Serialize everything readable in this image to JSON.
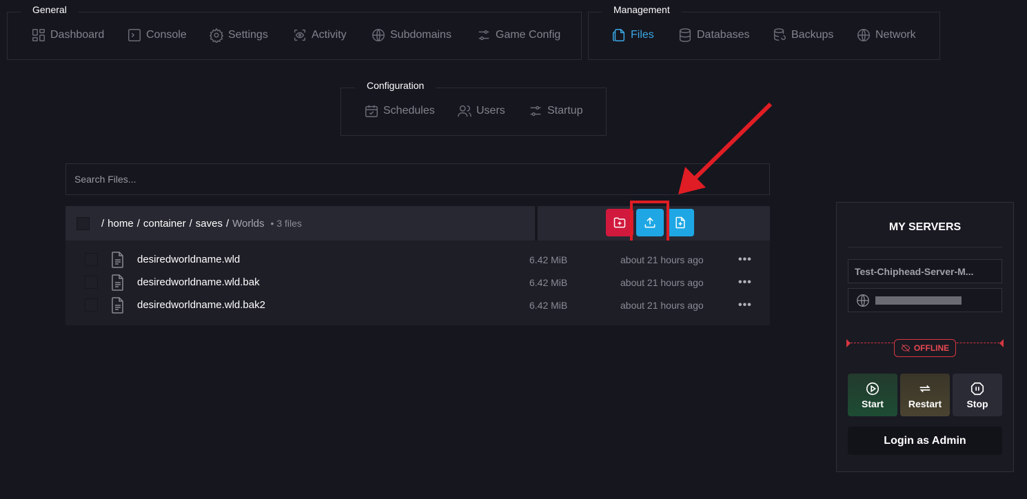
{
  "groups": {
    "general": {
      "title": "General",
      "items": [
        "Dashboard",
        "Console",
        "Settings",
        "Activity",
        "Subdomains",
        "Game Config"
      ]
    },
    "management": {
      "title": "Management",
      "items": [
        "Files",
        "Databases",
        "Backups",
        "Network"
      ],
      "active": "Files"
    },
    "configuration": {
      "title": "Configuration",
      "items": [
        "Schedules",
        "Users",
        "Startup"
      ]
    }
  },
  "search": {
    "placeholder": "Search Files..."
  },
  "breadcrumb": {
    "parts": [
      "/",
      "home",
      "/",
      "container",
      "/",
      "saves",
      "/"
    ],
    "current": "Worlds",
    "count": "• 3 files"
  },
  "actions": {
    "new_folder_icon": "folder-plus-icon",
    "upload_icon": "upload-icon",
    "new_file_icon": "file-plus-icon",
    "colors": {
      "new_folder": "#d1193d",
      "upload": "#1ea7e4",
      "new_file": "#1ea7e4",
      "highlight": "#e01d24"
    }
  },
  "files": [
    {
      "name": "desiredworldname.wld",
      "size": "6.42 MiB",
      "modified": "about 21 hours ago"
    },
    {
      "name": "desiredworldname.wld.bak",
      "size": "6.42 MiB",
      "modified": "about 21 hours ago"
    },
    {
      "name": "desiredworldname.wld.bak2",
      "size": "6.42 MiB",
      "modified": "about 21 hours ago"
    }
  ],
  "more_glyph": "•••",
  "server_panel": {
    "title": "MY SERVERS",
    "server_name": "Test-Chiphead-Server-M...",
    "status": "OFFLINE",
    "status_color": "#e64851",
    "buttons": {
      "start": "Start",
      "restart": "Restart",
      "stop": "Stop"
    },
    "login_admin": "Login as Admin"
  }
}
